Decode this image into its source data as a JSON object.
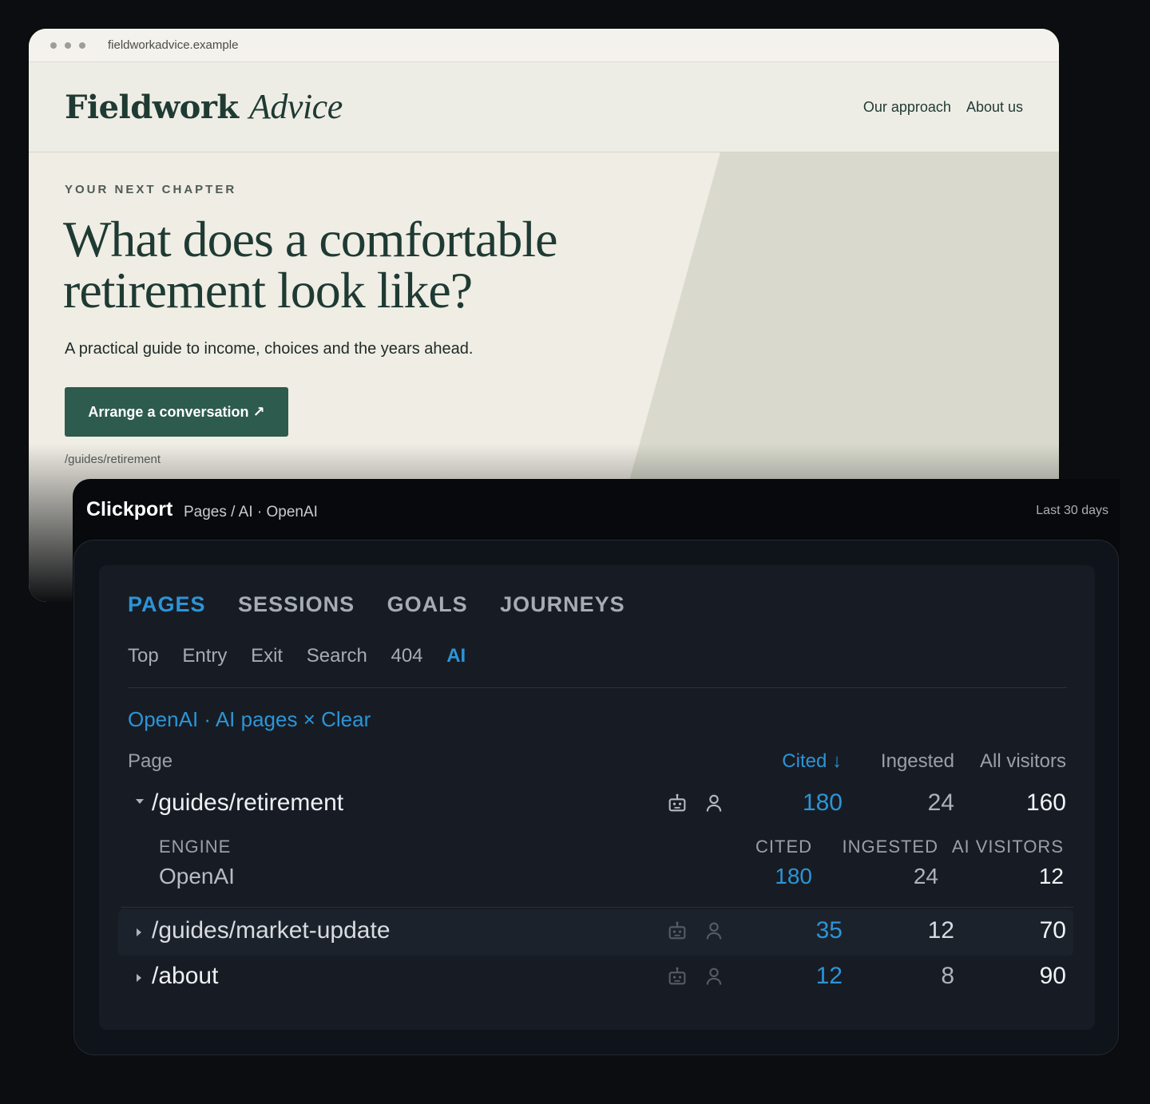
{
  "browser": {
    "url": "fieldworkadvice.example",
    "site": {
      "logo_main": "Fieldwork",
      "logo_accent": "Advice",
      "nav": [
        "Our approach",
        "About us"
      ],
      "eyebrow": "YOUR NEXT CHAPTER",
      "title": "What does a comfortable retirement look like?",
      "subtitle": "A practical guide to income, choices and the years ahead.",
      "cta": "Arrange a conversation ↗",
      "path": "/guides/retirement"
    }
  },
  "analytics": {
    "app_name": "Clickport",
    "breadcrumb": "Pages / AI · OpenAI",
    "date_range": "Last 30 days",
    "tabs": [
      "PAGES",
      "SESSIONS",
      "GOALS",
      "JOURNEYS"
    ],
    "active_tab": "PAGES",
    "subtabs": [
      "Top",
      "Entry",
      "Exit",
      "Search",
      "404",
      "AI"
    ],
    "active_subtab": "AI",
    "filter": {
      "label": "OpenAI · AI pages",
      "clear": "× Clear"
    },
    "columns": {
      "page": "Page",
      "cited": "Cited ↓",
      "ingested": "Ingested",
      "all_visitors": "All visitors"
    },
    "rows": [
      {
        "path": "/guides/retirement",
        "cited": "180",
        "ingested": "24",
        "all_visitors": "160",
        "expanded": true,
        "detail": {
          "headers": {
            "engine": "ENGINE",
            "cited": "CITED",
            "ingested": "INGESTED",
            "ai_visitors": "AI VISITORS"
          },
          "engine": "OpenAI",
          "cited": "180",
          "ingested": "24",
          "ai_visitors": "12"
        }
      },
      {
        "path": "/guides/market-update",
        "cited": "35",
        "ingested": "12",
        "all_visitors": "70",
        "expanded": false
      },
      {
        "path": "/about",
        "cited": "12",
        "ingested": "8",
        "all_visitors": "90",
        "expanded": false
      }
    ],
    "icons": [
      "robot-icon",
      "person-icon"
    ],
    "colors": {
      "accent": "#2d94d6",
      "panel_bg": "#171c24",
      "site_green": "#2d5b4d"
    }
  }
}
